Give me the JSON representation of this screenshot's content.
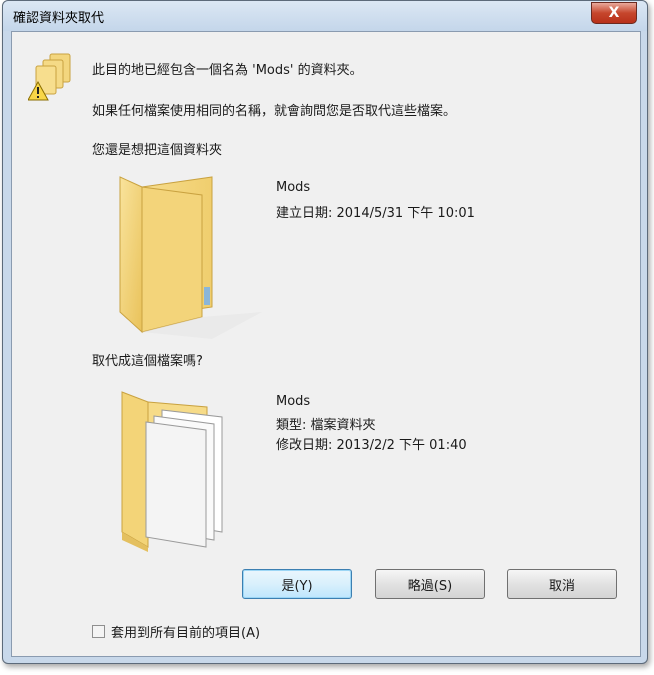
{
  "window": {
    "title": "確認資料夾取代",
    "close_glyph": "X"
  },
  "messages": {
    "line1": "此目的地已經包含一個名為 'Mods' 的資料夾。",
    "line2": "如果任何檔案使用相同的名稱，就會詢問您是否取代這些檔案。",
    "line3": "您還是想把這個資料夾"
  },
  "existing_folder": {
    "name": "Mods",
    "created": "建立日期: 2014/5/31 下午 10:01"
  },
  "replace_question": "取代成這個檔案嗎?",
  "incoming_folder": {
    "name": "Mods",
    "type": "類型: 檔案資料夾",
    "modified": "修改日期: 2013/2/2 下午 01:40"
  },
  "buttons": {
    "yes": "是(Y)",
    "skip": "略過(S)",
    "cancel": "取消"
  },
  "apply_all": {
    "label": "套用到所有目前的項目(A)",
    "checked": false
  },
  "colors": {
    "frame": "#c8d8ea",
    "client": "#f0f0f0",
    "close": "#c6462c",
    "folder": "#f5d57a"
  }
}
